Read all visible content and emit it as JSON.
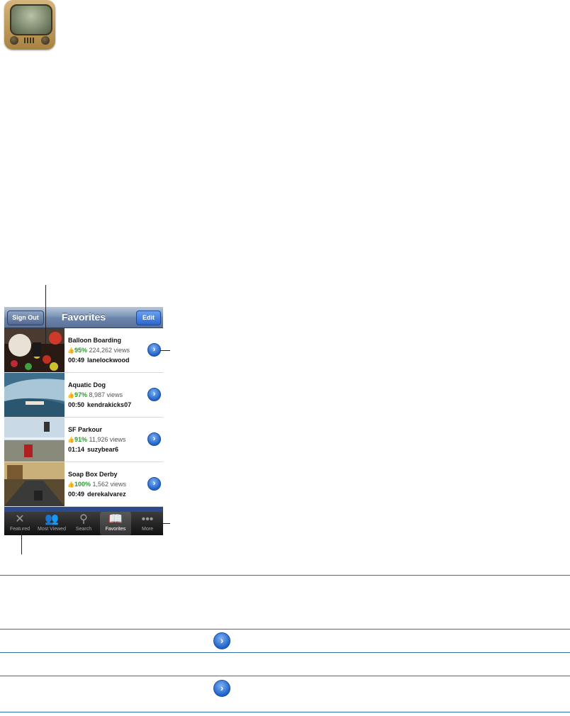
{
  "navbar": {
    "title": "Favorites",
    "left_button": "Sign Out",
    "right_button": "Edit"
  },
  "videos": [
    {
      "title": "Balloon Boarding",
      "rating": "95%",
      "views": "224,262 views",
      "duration": "00:49",
      "user": "lanelockwood"
    },
    {
      "title": "Aquatic Dog",
      "rating": "97%",
      "views": "8,987 views",
      "duration": "00:50",
      "user": "kendrakicks07"
    },
    {
      "title": "SF Parkour",
      "rating": "91%",
      "views": "11,926 views",
      "duration": "01:14",
      "user": "suzybear6"
    },
    {
      "title": "Soap Box Derby",
      "rating": "100%",
      "views": "1,562 views",
      "duration": "00:49",
      "user": "derekalvarez"
    }
  ],
  "tabs": [
    {
      "label": "Featured",
      "icon": "featured-icon"
    },
    {
      "label": "Most Viewed",
      "icon": "most-viewed-icon"
    },
    {
      "label": "Search",
      "icon": "search-icon"
    },
    {
      "label": "Favorites",
      "icon": "favorites-icon"
    },
    {
      "label": "More",
      "icon": "more-icon"
    }
  ],
  "glyphs": {
    "disclosure": "›",
    "thumbs_up": "👍"
  },
  "colors": {
    "accent": "#2f6fa8",
    "rating": "#2b9a2b",
    "nav_blue": "#6d86ab"
  }
}
